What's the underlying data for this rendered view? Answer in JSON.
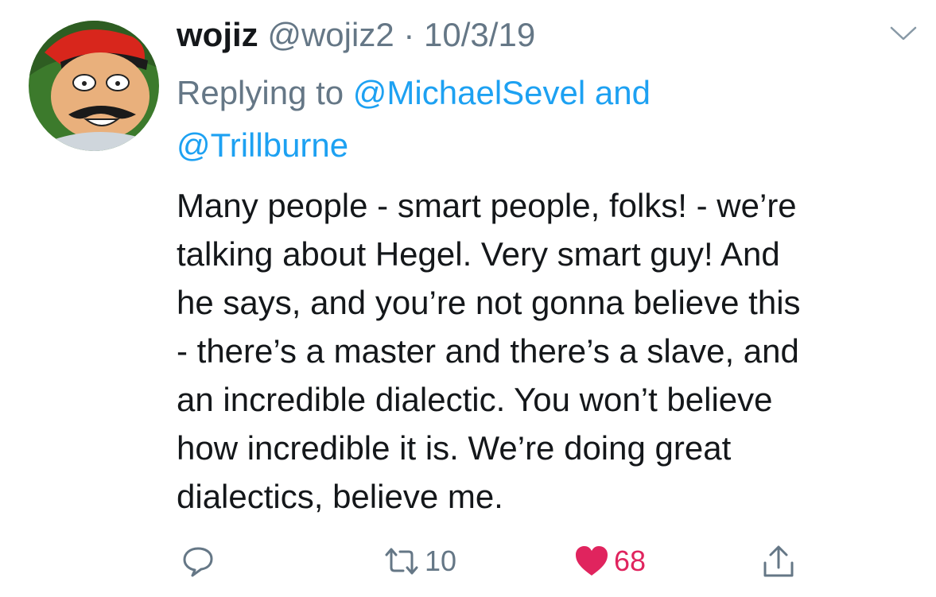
{
  "tweet": {
    "display_name": "wojiz",
    "handle": "@wojiz2",
    "separator": "·",
    "date": "10/3/19",
    "replying_to_label": "Replying to",
    "mention_1": "@MichaelSevel",
    "and_label": "and",
    "mention_2": "@Trillburne",
    "text": "Many people - smart people, folks! - we’re\ntalking about Hegel. Very smart guy! And\nhe says, and you’re not gonna believe this\n- there’s a master and there’s a slave, and\nan incredible dialectic. You won’t believe\nhow incredible it is. We’re doing great\ndialectics, believe me."
  },
  "actions": {
    "reply_icon": "reply-bubble-icon",
    "retweet_icon": "retweet-icon",
    "retweet_count": "10",
    "like_icon": "heart-icon",
    "like_count": "68",
    "share_icon": "share-icon"
  },
  "colors": {
    "text_primary": "#14171a",
    "text_secondary": "#657786",
    "link": "#1da1f2",
    "like": "#e0245e"
  }
}
